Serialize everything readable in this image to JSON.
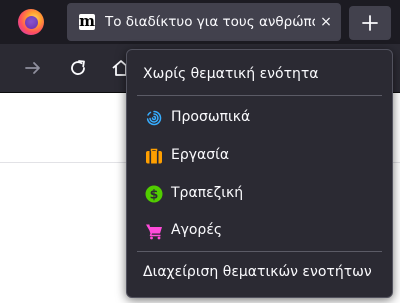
{
  "tab": {
    "favicon_letter": "m",
    "title": "Το διαδίκτυο για τους ανθρώπους",
    "close_symbol": "×"
  },
  "menu": {
    "no_container": "Χωρίς θεματική ενότητα",
    "containers": [
      {
        "label": "Προσωπικά",
        "icon": "fingerprint-icon",
        "color": "#37adff"
      },
      {
        "label": "Εργασία",
        "icon": "briefcase-icon",
        "color": "#ff9f00"
      },
      {
        "label": "Τραπεζική",
        "icon": "dollar-icon",
        "color": "#51cd00"
      },
      {
        "label": "Αγορές",
        "icon": "cart-icon",
        "color": "#ff4bda"
      }
    ],
    "manage": "Διαχείριση θεματικών ενοτήτων"
  },
  "theme": {
    "tab_bar_bg": "#1c1b22",
    "toolbar_bg": "#2b2a33",
    "menu_text": "#fbfbfe"
  }
}
